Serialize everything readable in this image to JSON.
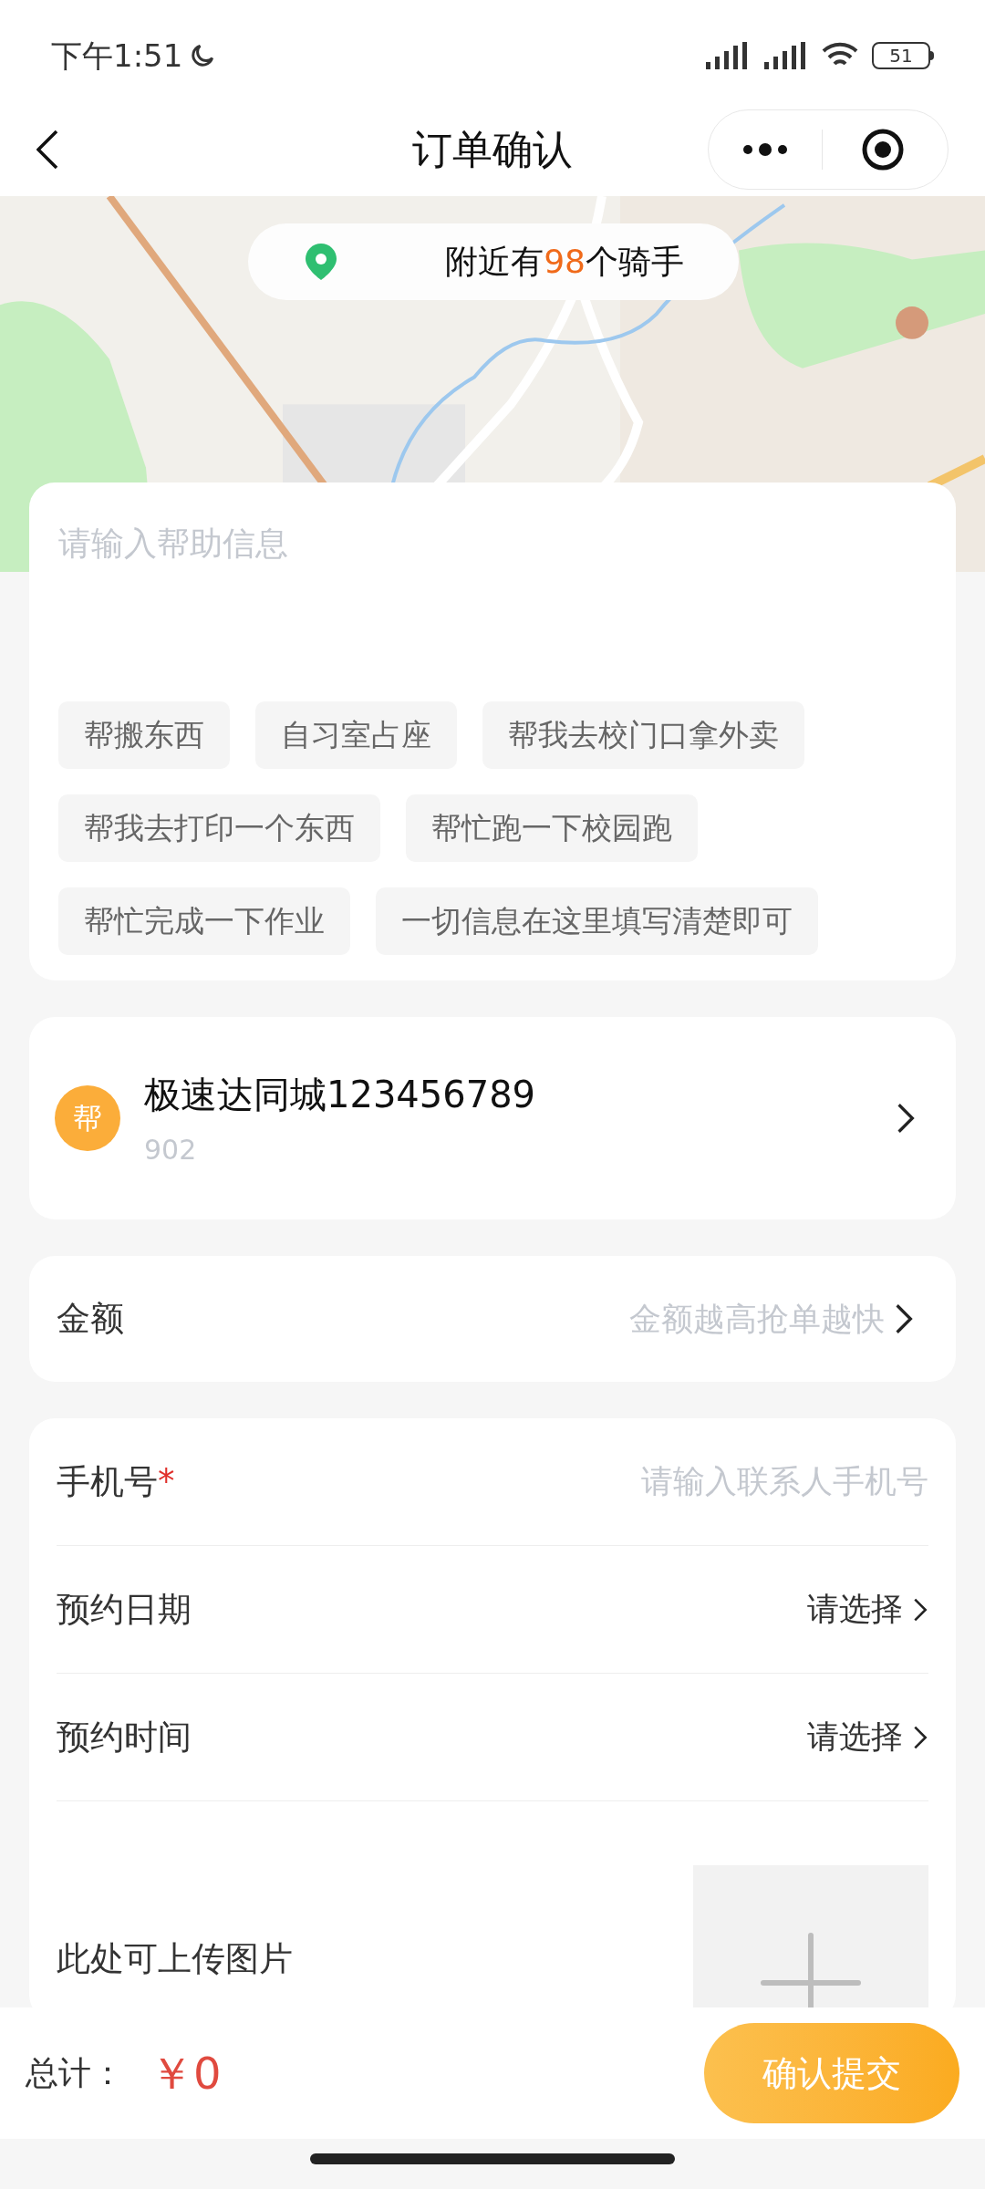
{
  "status_bar": {
    "time": "下午1:51",
    "battery": "51"
  },
  "nav": {
    "title": "订单确认"
  },
  "map": {
    "riders": {
      "prefix": "附近有",
      "count": "98",
      "suffix": "个骑手"
    }
  },
  "help": {
    "placeholder": "请输入帮助信息",
    "tags": [
      "帮搬东西",
      "自习室占座",
      "帮我去校门口拿外卖",
      "帮我去打印一个东西",
      "帮忙跑一下校园跑",
      "帮忙完成一下作业",
      "一切信息在这里填写清楚即可"
    ]
  },
  "service": {
    "badge": "帮",
    "name": "极速达同城123456789",
    "code": "902"
  },
  "amount": {
    "label": "金额",
    "placeholder": "金额越高抢单越快"
  },
  "form_rows": [
    {
      "kind": "input",
      "label": "手机号",
      "required_mark": "*",
      "placeholder": "请输入联系人手机号"
    },
    {
      "kind": "select",
      "label": "预约日期",
      "value": "请选择"
    },
    {
      "kind": "select",
      "label": "预约时间",
      "value": "请选择"
    }
  ],
  "upload": {
    "label": "此处可上传图片"
  },
  "footer": {
    "total_label": "总计：",
    "total": "￥0",
    "submit": "确认提交"
  }
}
